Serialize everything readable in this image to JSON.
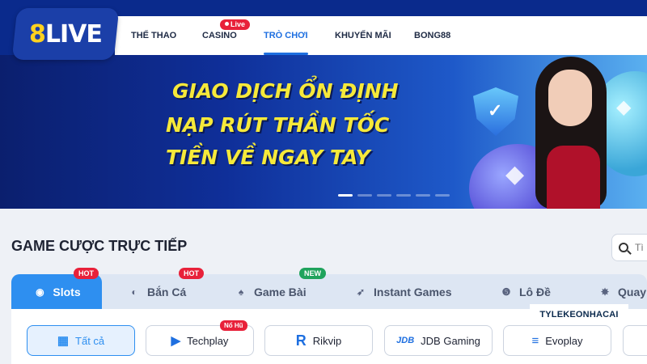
{
  "header": {
    "logo": {
      "part1": "8",
      "part2": "LIVE"
    },
    "nav": [
      {
        "label": "THỂ THAO"
      },
      {
        "label": "CASINO",
        "badge": "Live"
      },
      {
        "label": "TRÒ CHƠI",
        "active": true
      },
      {
        "label": "KHUYẾN MÃI"
      },
      {
        "label": "BONG88"
      }
    ]
  },
  "banner": {
    "lines": [
      "GIAO DỊCH ỔN ĐỊNH",
      "NẠP RÚT THẦN TỐC",
      "TIỀN VỀ NGAY TAY"
    ],
    "slides": 6,
    "active_slide": 0
  },
  "section": {
    "title": "GAME CƯỢC TRỰC TIẾP",
    "search_placeholder": "Tì"
  },
  "categories": [
    {
      "label": "Slots",
      "tag": "HOT",
      "active": true,
      "icon": "slots-icon"
    },
    {
      "label": "Bắn Cá",
      "tag": "HOT",
      "icon": "fish-icon"
    },
    {
      "label": "Game Bài",
      "tag": "NEW",
      "icon": "cards-icon"
    },
    {
      "label": "Instant Games",
      "icon": "rocket-icon"
    },
    {
      "label": "Lô Đề",
      "icon": "lottery-icon"
    },
    {
      "label": "Quay",
      "icon": "wheel-icon"
    }
  ],
  "providers": [
    {
      "label": "Tất cả",
      "active": true,
      "icon": "grid-icon"
    },
    {
      "label": "Techplay",
      "tag": "Nổ Hũ",
      "icon": "techplay-icon"
    },
    {
      "label": "Rikvip",
      "icon": "rikvip-icon"
    },
    {
      "label": "JDB Gaming",
      "icon": "jdb-icon"
    },
    {
      "label": "Evoplay",
      "icon": "evoplay-icon"
    }
  ],
  "watermark": "TYLEKEONHACAI",
  "colors": {
    "brand": "#0a2a8c",
    "accent": "#2e8ff0",
    "hot": "#e8213a",
    "new": "#1fa35c",
    "banner_text": "#f6e93a"
  }
}
